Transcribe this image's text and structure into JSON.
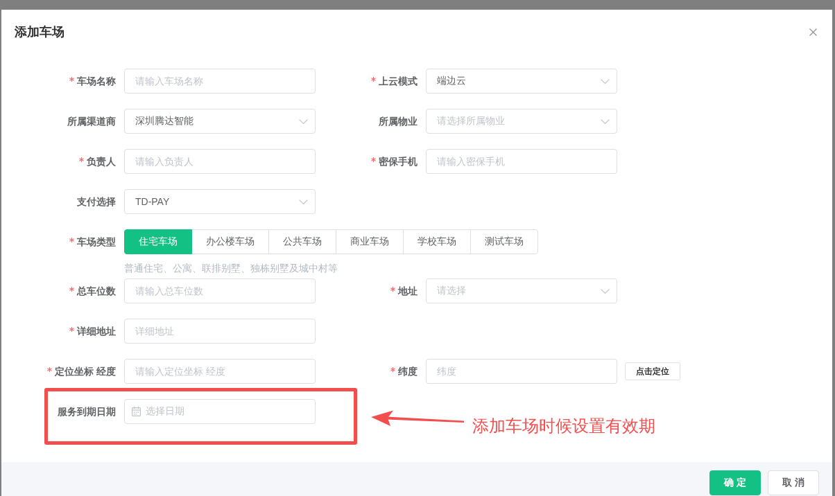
{
  "dialog": {
    "title": "添加车场"
  },
  "form": {
    "rows": [
      {
        "highlighted": false,
        "fields": [
          {
            "label": "车场名称",
            "required": true,
            "kind": "input",
            "placeholder": "请输入车场名称"
          },
          {
            "label": "上云模式",
            "required": true,
            "kind": "select",
            "value": "端边云"
          }
        ]
      },
      {
        "highlighted": false,
        "fields": [
          {
            "label": "所属渠道商",
            "required": false,
            "kind": "select",
            "value": "深圳腾达智能"
          },
          {
            "label": "所属物业",
            "required": false,
            "kind": "select",
            "placeholder": "请选择所属物业"
          }
        ]
      },
      {
        "highlighted": false,
        "fields": [
          {
            "label": "负责人",
            "required": true,
            "kind": "input",
            "placeholder": "请输入负责人"
          },
          {
            "label": "密保手机",
            "required": true,
            "kind": "input",
            "placeholder": "请输入密保手机"
          }
        ]
      },
      {
        "highlighted": false,
        "fields": [
          {
            "label": "支付选择",
            "required": false,
            "kind": "select",
            "value": "TD-PAY"
          }
        ]
      },
      {
        "highlighted": false,
        "fields": [
          {
            "label": "车场类型",
            "required": true,
            "kind": "segmented",
            "options": [
              {
                "label": "住宅车场",
                "selected": true
              },
              {
                "label": "办公楼车场",
                "selected": false
              },
              {
                "label": "公共车场",
                "selected": false
              },
              {
                "label": "商业车场",
                "selected": false
              },
              {
                "label": "学校车场",
                "selected": false
              },
              {
                "label": "测试车场",
                "selected": false
              }
            ],
            "hint": "普通住宅、公寓、联排别墅、独栋别墅及城中村等"
          }
        ]
      },
      {
        "highlighted": false,
        "fields": [
          {
            "label": "总车位数",
            "required": true,
            "kind": "input",
            "placeholder": "请输入总车位数"
          },
          {
            "label": "地址",
            "required": true,
            "kind": "select",
            "placeholder": "请选择"
          }
        ]
      },
      {
        "highlighted": false,
        "fields": [
          {
            "label": "详细地址",
            "required": true,
            "kind": "input",
            "placeholder": "详细地址"
          }
        ]
      },
      {
        "highlighted": false,
        "fields": [
          {
            "label": "定位坐标 经度",
            "required": true,
            "kind": "input",
            "placeholder": "请输入定位坐标 经度"
          },
          {
            "label": "纬度",
            "required": true,
            "kind": "input",
            "placeholder": "纬度",
            "button": "点击定位"
          }
        ]
      },
      {
        "highlighted": true,
        "note": "添加车场时候设置有效期",
        "fields": [
          {
            "label": "服务到期日期",
            "required": false,
            "kind": "date",
            "placeholder": "选择日期"
          }
        ]
      }
    ]
  },
  "footer": {
    "buttons": [
      {
        "label": "确 定",
        "kind": "primary"
      },
      {
        "label": "取 消",
        "kind": "default"
      }
    ]
  }
}
